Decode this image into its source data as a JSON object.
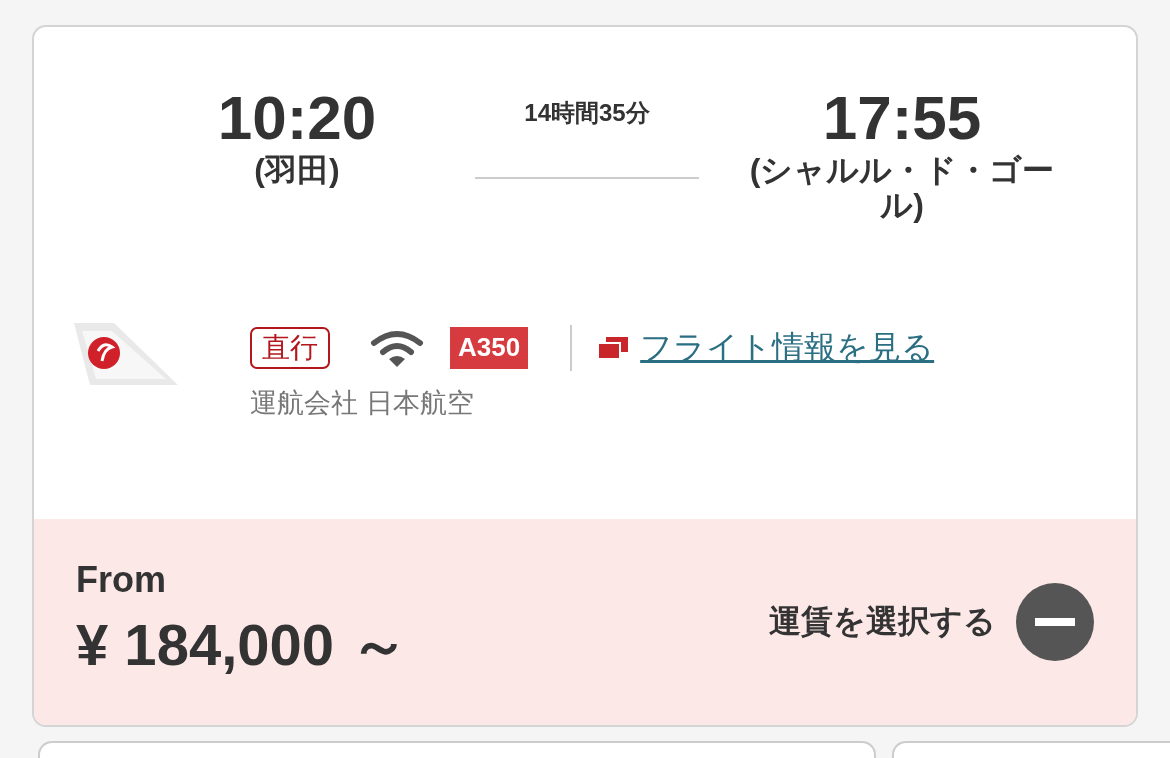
{
  "departure": {
    "time": "10:20",
    "airport": "(羽田)"
  },
  "duration": "14時間35分",
  "arrival": {
    "time": "17:55",
    "airport": "(シャルル・ド・ゴール)"
  },
  "badges": [
    {
      "kind": "nonstop",
      "label": "直行"
    },
    {
      "kind": "wifi"
    },
    {
      "kind": "aircraft",
      "label": "A350"
    }
  ],
  "flight_info_link": "フライト情報を見る",
  "operator": "運航会社 日本航空",
  "fare": {
    "prefix": "From",
    "price": "¥ 184,000 ～",
    "select_label": "運賃を選択する",
    "expanded": true
  }
}
